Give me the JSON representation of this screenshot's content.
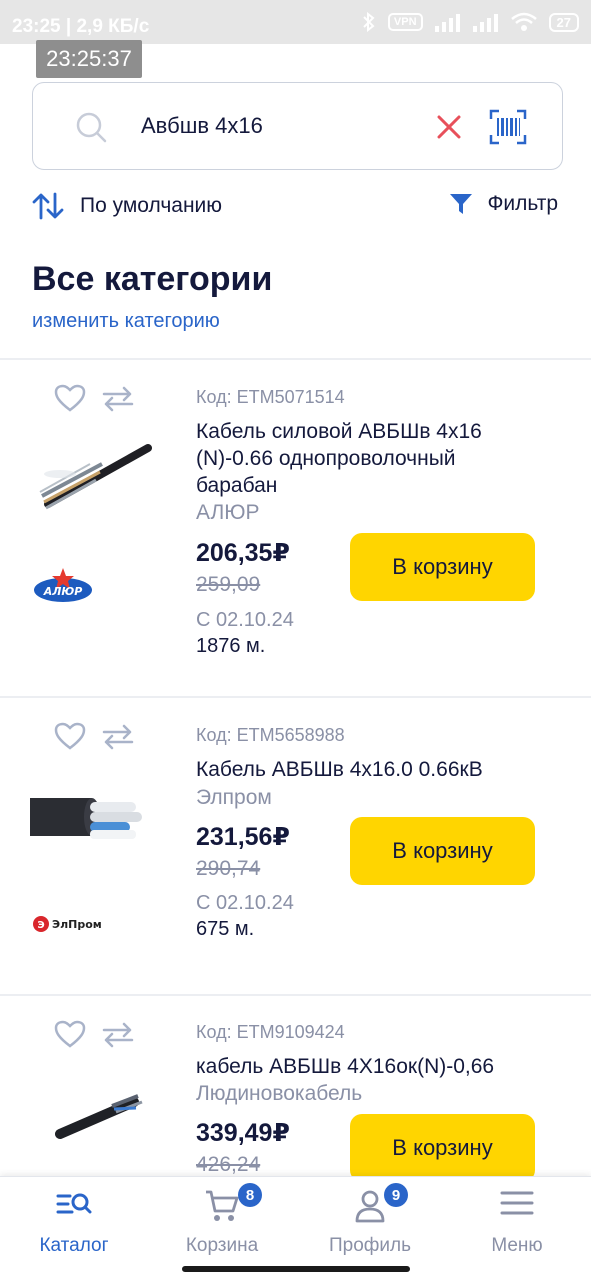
{
  "status_bar": {
    "left_text": "23:25 | 2,9 КБ/с",
    "vpn_label": "VPN",
    "battery": "27",
    "clock_overlay": "23:25:37"
  },
  "search": {
    "value": "Авбшв 4х16"
  },
  "sort": {
    "label": "По умолчанию"
  },
  "filter": {
    "label": "Фильтр"
  },
  "heading": "Все категории",
  "change_category": "изменить категорию",
  "products": [
    {
      "code": "Код: ETM5071514",
      "title": "Кабель силовой АВБШв 4х16 (N)-0.66 однопроволочный барабан",
      "maker": "АЛЮР",
      "price": "206,35₽",
      "old_price": "259,09",
      "date": "С 02.10.24",
      "qty": "1876 м.",
      "button": "В корзину",
      "brand_logo": "АЛЮР"
    },
    {
      "code": "Код: ETM5658988",
      "title": "Кабель АВБШв 4х16.0 0.66кВ",
      "maker": "Элпром",
      "price": "231,56₽",
      "old_price": "290,74",
      "date": "С 02.10.24",
      "qty": "675 м.",
      "button": "В корзину",
      "brand_logo": "ЭлПром"
    },
    {
      "code": "Код: ETM9109424",
      "title": "кабель АВБШв 4Х16ок(N)-0,66",
      "maker": "Людиновокабель",
      "price": "339,49₽",
      "old_price": "426,24",
      "button": "В корзину"
    }
  ],
  "bottom_nav": [
    {
      "label": "Каталог",
      "icon": "catalog-search-icon",
      "active": true
    },
    {
      "label": "Корзина",
      "icon": "cart-icon",
      "badge": "8"
    },
    {
      "label": "Профиль",
      "icon": "profile-icon",
      "badge": "9"
    },
    {
      "label": "Меню",
      "icon": "menu-icon"
    }
  ],
  "colors": {
    "accent": "#2a65c9",
    "button": "#ffd500",
    "text": "#14193c",
    "muted": "#8a90a6",
    "clear": "#e8505b"
  }
}
